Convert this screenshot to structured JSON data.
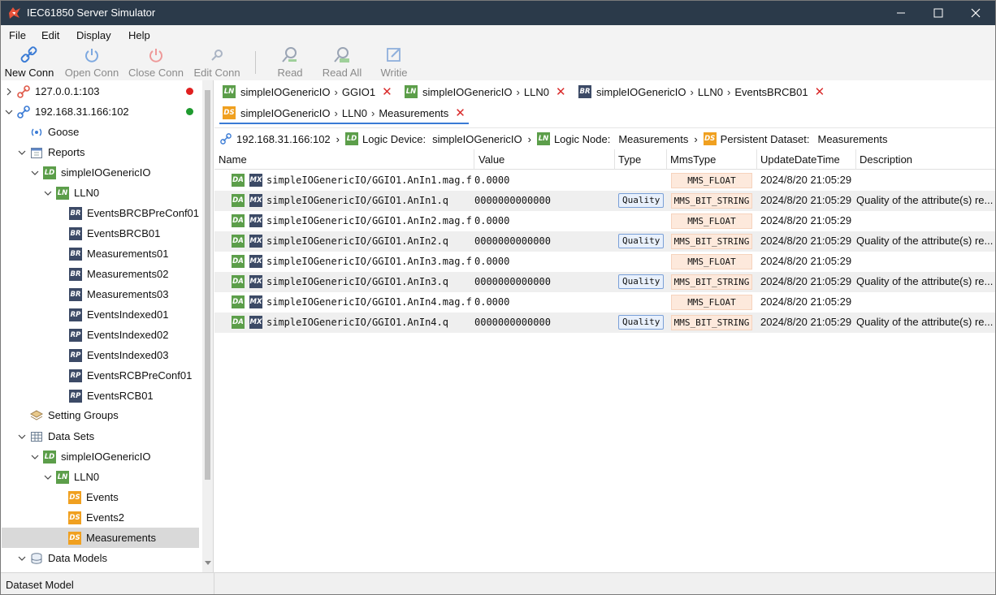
{
  "window": {
    "title": "IEC61850 Server Simulator",
    "titlebar_color": "#2b3a4a"
  },
  "menu": [
    "File",
    "Edit",
    "Display",
    "Help"
  ],
  "toolbar": {
    "new_conn": "New Conn",
    "open_conn": "Open Conn",
    "close_conn": "Close Conn",
    "edit_conn": "Edit Conn",
    "read": "Read",
    "read_all": "Read All",
    "write": "Writie"
  },
  "tree": {
    "conn1": {
      "label": "127.0.0.1:103",
      "status_color": "#e02020"
    },
    "conn2": {
      "label": "192.168.31.166:102",
      "status_color": "#1f9a2f"
    },
    "goose": "Goose",
    "reports": "Reports",
    "reports_ld": {
      "badge": "LD",
      "label": "simpleIOGenericIO"
    },
    "reports_ln": {
      "badge": "LN",
      "label": "LLN0"
    },
    "report_items": [
      {
        "badge": "BR",
        "label": "EventsBRCBPreConf01"
      },
      {
        "badge": "BR",
        "label": "EventsBRCB01"
      },
      {
        "badge": "BR",
        "label": "Measurements01"
      },
      {
        "badge": "BR",
        "label": "Measurements02"
      },
      {
        "badge": "BR",
        "label": "Measurements03"
      },
      {
        "badge": "RP",
        "label": "EventsIndexed01"
      },
      {
        "badge": "RP",
        "label": "EventsIndexed02"
      },
      {
        "badge": "RP",
        "label": "EventsIndexed03"
      },
      {
        "badge": "RP",
        "label": "EventsRCBPreConf01"
      },
      {
        "badge": "RP",
        "label": "EventsRCB01"
      }
    ],
    "setting_groups": "Setting Groups",
    "data_sets": "Data Sets",
    "ds_ld": {
      "badge": "LD",
      "label": "simpleIOGenericIO"
    },
    "ds_ln": {
      "badge": "LN",
      "label": "LLN0"
    },
    "ds_items": [
      {
        "badge": "DS",
        "label": "Events"
      },
      {
        "badge": "DS",
        "label": "Events2"
      },
      {
        "badge": "DS",
        "label": "Measurements"
      }
    ],
    "data_models": "Data Models"
  },
  "tabs": [
    {
      "badge": "LN",
      "parts": [
        "simpleIOGenericIO",
        "GGIO1"
      ]
    },
    {
      "badge": "LN",
      "parts": [
        "simpleIOGenericIO",
        "LLN0"
      ]
    },
    {
      "badge": "BR",
      "parts": [
        "simpleIOGenericIO",
        "LLN0",
        "EventsBRCB01"
      ]
    },
    {
      "badge": "DS",
      "parts": [
        "simpleIOGenericIO",
        "LLN0",
        "Measurements"
      ]
    }
  ],
  "breadcrumb": {
    "host": "192.168.31.166:102",
    "ld_label": "Logic Device:",
    "ld_value": "simpleIOGenericIO",
    "ln_label": "Logic Node:",
    "ln_value": "Measurements",
    "ds_label": "Persistent Dataset:",
    "ds_value": "Measurements"
  },
  "grid": {
    "columns": [
      "Name",
      "Value",
      "Type",
      "MmsType",
      "UpdateDateTime",
      "Description"
    ],
    "rows": [
      {
        "name": "simpleIOGenericIO/GGIO1.AnIn1.mag.f",
        "value": "0.0000",
        "type": "",
        "mms": "MMS_FLOAT",
        "time": "2024/8/20 21:05:29",
        "desc": ""
      },
      {
        "name": "simpleIOGenericIO/GGIO1.AnIn1.q",
        "value": "0000000000000",
        "type": "Quality",
        "mms": "MMS_BIT_STRING",
        "time": "2024/8/20 21:05:29",
        "desc": "Quality of the attribute(s) re..."
      },
      {
        "name": "simpleIOGenericIO/GGIO1.AnIn2.mag.f",
        "value": "0.0000",
        "type": "",
        "mms": "MMS_FLOAT",
        "time": "2024/8/20 21:05:29",
        "desc": ""
      },
      {
        "name": "simpleIOGenericIO/GGIO1.AnIn2.q",
        "value": "0000000000000",
        "type": "Quality",
        "mms": "MMS_BIT_STRING",
        "time": "2024/8/20 21:05:29",
        "desc": "Quality of the attribute(s) re..."
      },
      {
        "name": "simpleIOGenericIO/GGIO1.AnIn3.mag.f",
        "value": "0.0000",
        "type": "",
        "mms": "MMS_FLOAT",
        "time": "2024/8/20 21:05:29",
        "desc": ""
      },
      {
        "name": "simpleIOGenericIO/GGIO1.AnIn3.q",
        "value": "0000000000000",
        "type": "Quality",
        "mms": "MMS_BIT_STRING",
        "time": "2024/8/20 21:05:29",
        "desc": "Quality of the attribute(s) re..."
      },
      {
        "name": "simpleIOGenericIO/GGIO1.AnIn4.mag.f",
        "value": "0.0000",
        "type": "",
        "mms": "MMS_FLOAT",
        "time": "2024/8/20 21:05:29",
        "desc": ""
      },
      {
        "name": "simpleIOGenericIO/GGIO1.AnIn4.q",
        "value": "0000000000000",
        "type": "Quality",
        "mms": "MMS_BIT_STRING",
        "time": "2024/8/20 21:05:29",
        "desc": "Quality of the attribute(s) re..."
      }
    ]
  },
  "status": {
    "text": "Dataset Model"
  }
}
